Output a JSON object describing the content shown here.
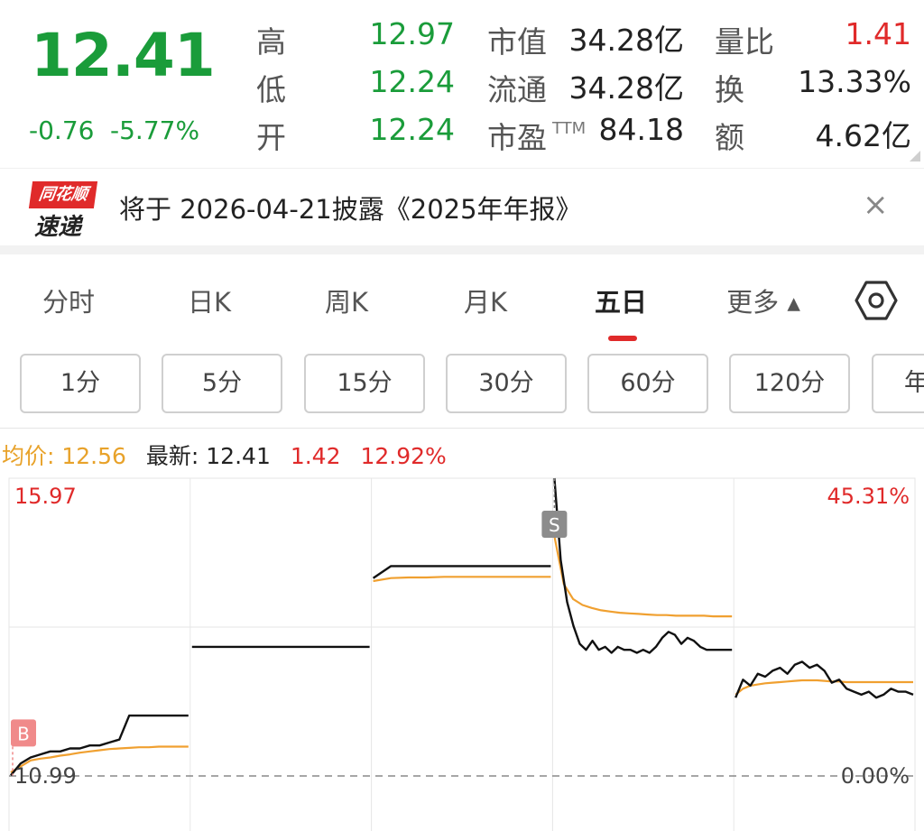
{
  "quote": {
    "price": "12.41",
    "change": "-0.76",
    "change_pct": "-5.77%",
    "rows": [
      {
        "l1": "高",
        "v1": "12.97",
        "l2": "市值",
        "v2": "34.28亿",
        "l3": "量比",
        "v3": "1.41"
      },
      {
        "l1": "低",
        "v1": "12.24",
        "l2": "流通",
        "v2": "34.28亿",
        "l3": "换",
        "v3": "13.33%"
      },
      {
        "l1": "开",
        "v1": "12.24",
        "l2": "市盈",
        "l2_sup": "TTM",
        "v2": "84.18",
        "l3": "额",
        "v3": "4.62亿"
      }
    ]
  },
  "banner": {
    "logo_top": "同花顺",
    "logo_bottom": "速递",
    "text": "将于 2026-04-21披露《2025年年报》",
    "close_glyph": "×"
  },
  "tabs": [
    {
      "label": "分时"
    },
    {
      "label": "日K"
    },
    {
      "label": "周K"
    },
    {
      "label": "月K"
    },
    {
      "label": "五日",
      "active": true
    },
    {
      "label": "更多 ▴"
    }
  ],
  "chips": [
    "1分",
    "5分",
    "15分",
    "30分",
    "60分",
    "120分",
    "年"
  ],
  "legend": {
    "avg_label": "均价: ",
    "avg_value": "12.56",
    "last_label": "最新: ",
    "last_value": "12.41",
    "chg": "1.42",
    "chg_pct": "12.92%"
  },
  "chart_data": {
    "type": "line",
    "days": 5,
    "y_max_label": "15.97",
    "y_min_label": "10.99",
    "pct_max_label": "45.31%",
    "pct_min_label": "0.00%",
    "ylim": [
      10.99,
      15.97
    ],
    "buy_marker": "B",
    "sell_marker": "S",
    "colors": {
      "price": "#111111",
      "avg": "#f0a030",
      "grid": "#e6e6e6",
      "red": "#e02a2a"
    },
    "series": [
      {
        "name": "最新",
        "values": [
          [
            11.0,
            11.2,
            11.3,
            11.35,
            11.4,
            11.4,
            11.45,
            11.45,
            11.5,
            11.5,
            11.55,
            11.6,
            12.0,
            12.0,
            12.0,
            12.0,
            12.0,
            12.0,
            12.0
          ],
          [
            13.15,
            13.15,
            13.15,
            13.15,
            13.15,
            13.15,
            13.15,
            13.15,
            13.15,
            13.15
          ],
          [
            14.3,
            14.5,
            14.5,
            14.5,
            14.5,
            14.5,
            14.5,
            14.5,
            14.5,
            14.5,
            14.5
          ],
          [
            15.97,
            14.6,
            13.9,
            13.5,
            13.2,
            13.1,
            13.25,
            13.1,
            13.15,
            13.05,
            13.15,
            13.1,
            13.1,
            13.05,
            13.1,
            13.05,
            13.15,
            13.3,
            13.4,
            13.35,
            13.2,
            13.3,
            13.25,
            13.15,
            13.1,
            13.1,
            13.1,
            13.1,
            13.1
          ],
          [
            12.3,
            12.6,
            12.5,
            12.7,
            12.65,
            12.75,
            12.8,
            12.7,
            12.85,
            12.9,
            12.8,
            12.85,
            12.75,
            12.55,
            12.6,
            12.45,
            12.4,
            12.35,
            12.4,
            12.3,
            12.35,
            12.45,
            12.4,
            12.4,
            12.35
          ]
        ]
      },
      {
        "name": "均价",
        "values": [
          [
            11.05,
            11.15,
            11.25,
            11.28,
            11.3,
            11.33,
            11.35,
            11.38,
            11.4,
            11.42,
            11.44,
            11.45,
            11.46,
            11.47,
            11.47,
            11.48,
            11.48,
            11.48,
            11.48
          ],
          [],
          [
            14.25,
            14.3,
            14.31,
            14.31,
            14.32,
            14.32,
            14.32,
            14.32,
            14.32,
            14.32,
            14.32
          ],
          [
            15.0,
            14.2,
            13.95,
            13.85,
            13.8,
            13.76,
            13.74,
            13.72,
            13.71,
            13.7,
            13.69,
            13.68,
            13.68,
            13.67,
            13.67,
            13.67,
            13.67,
            13.66,
            13.66,
            13.66
          ],
          [
            12.35,
            12.45,
            12.5,
            12.52,
            12.54,
            12.55,
            12.56,
            12.57,
            12.58,
            12.59,
            12.59,
            12.59,
            12.58,
            12.57,
            12.57,
            12.56,
            12.56,
            12.56,
            12.56,
            12.56,
            12.56,
            12.56,
            12.56,
            12.56,
            12.56
          ]
        ]
      }
    ]
  }
}
